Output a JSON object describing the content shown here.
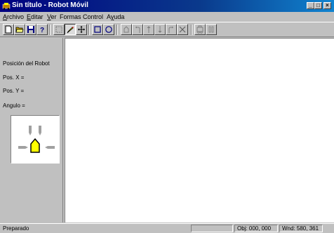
{
  "window": {
    "title": "Sin título - Robot Móvil",
    "controls": {
      "minimize": "_",
      "maximize": "□",
      "close": "×"
    }
  },
  "menubar": {
    "items": [
      {
        "label": "Archivo",
        "mnemonic": "A"
      },
      {
        "label": "Editar",
        "mnemonic": "E"
      },
      {
        "label": "Ver",
        "mnemonic": "V"
      },
      {
        "label": "Formas"
      },
      {
        "label": "Control"
      },
      {
        "label": "Ayuda",
        "mnemonic": "u"
      }
    ]
  },
  "toolbar": {
    "buttons": [
      {
        "icon": "new-document-icon"
      },
      {
        "icon": "open-folder-icon"
      },
      {
        "icon": "save-disk-icon"
      },
      {
        "icon": "help-icon"
      },
      {
        "icon": "select-icon"
      },
      {
        "icon": "pencil-icon",
        "pressed": true
      },
      {
        "icon": "move-arrows-icon"
      },
      {
        "icon": "rectangle-icon"
      },
      {
        "icon": "circle-icon"
      },
      {
        "icon": "robot-shape-icon"
      },
      {
        "icon": "turn-left-icon"
      },
      {
        "icon": "arrow-up-icon"
      },
      {
        "icon": "arrow-down-icon"
      },
      {
        "icon": "turn-right-icon"
      },
      {
        "icon": "stop-x-icon"
      },
      {
        "icon": "run-icon"
      },
      {
        "icon": "pause-icon"
      }
    ]
  },
  "side_panel": {
    "heading": "Posición del Robot",
    "pos_x_label": "Pos. X =",
    "pos_y_label": "Pos. Y =",
    "angle_label": "Angulo ="
  },
  "statusbar": {
    "status": "Preparado",
    "obj": "Obj: 000, 000",
    "wnd": "Wnd: 580, 361"
  },
  "colors": {
    "title_active": "#000080",
    "robot_body": "#ffff00",
    "sensor_gray": "#a0a0a0"
  }
}
